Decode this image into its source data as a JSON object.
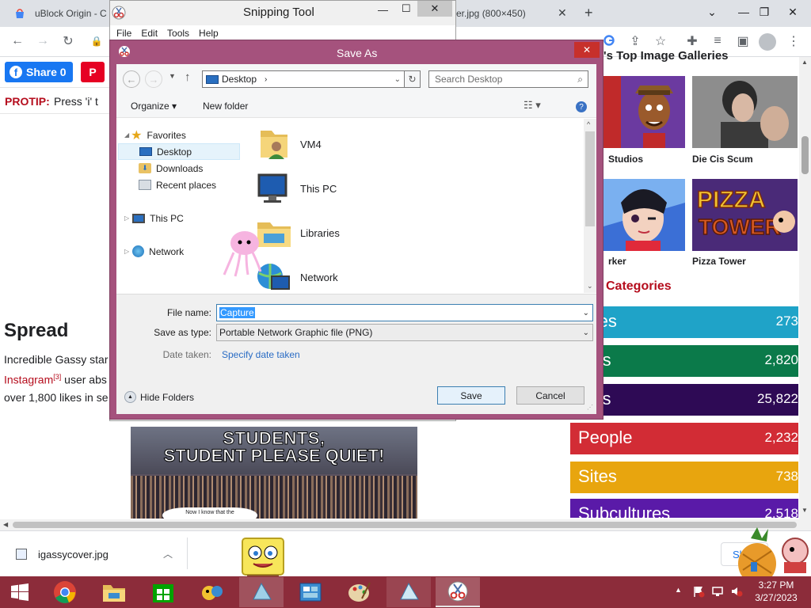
{
  "browser": {
    "tabs": [
      {
        "title": "uBlock Origin - C"
      },
      {
        "title": "er.jpg (800×450)"
      }
    ],
    "new_tab": "+",
    "controls": {
      "dropdown": "⌄",
      "minimize": "—",
      "restore": "❐",
      "close": "✕"
    }
  },
  "page": {
    "share_label": "Share 0",
    "protip_label": "PROTIP:",
    "protip_text": "Press 'i' t",
    "spread_heading": "Spread",
    "spread_line1": "Incredible Gassy star",
    "spread_link": "Instagram",
    "spread_sup": "[3]",
    "spread_line2_rest": " user abs",
    "spread_line3": "over 1,800 likes in se",
    "image_line1": "STUDENTS,",
    "image_line2": "STUDENT PLEASE QUIET!",
    "image_caption": "Now I know that the",
    "galleries_title": "'s Top Image Galleries",
    "gallery_items": [
      {
        "label": "Studios"
      },
      {
        "label": "Die Cis Scum"
      },
      {
        "label": "rker"
      },
      {
        "label": "Pizza Tower"
      }
    ],
    "pizza_logo_l1": "PIZZA",
    "pizza_logo_l2": "TOWER",
    "categories_title": "Categories",
    "categories": [
      {
        "name": "tures",
        "count": "273",
        "color": "#1fa3c8"
      },
      {
        "name": "ents",
        "count": "2,820",
        "color": "#0b7a4a"
      },
      {
        "name": "mes",
        "count": "25,822",
        "color": "#2e0a55"
      },
      {
        "name": "People",
        "count": "2,232",
        "color": "#d22c35"
      },
      {
        "name": "Sites",
        "count": "738",
        "color": "#e8a50e"
      },
      {
        "name": "Subcultures",
        "count": "2,518",
        "color": "#5a1aa8"
      }
    ]
  },
  "snipping": {
    "title": "Snipping Tool",
    "menu": [
      "File",
      "Edit",
      "Tools",
      "Help"
    ]
  },
  "dialog": {
    "title": "Save As",
    "location": "Desktop",
    "search_placeholder": "Search Desktop",
    "organize": "Organize",
    "new_folder": "New folder",
    "tree": [
      {
        "label": "Favorites",
        "icon": "star-icon"
      },
      {
        "label": "Desktop",
        "icon": "desktop-icon"
      },
      {
        "label": "Downloads",
        "icon": "downloads-icon"
      },
      {
        "label": "Recent places",
        "icon": "recent-places-icon"
      },
      {
        "label": "This PC",
        "icon": "computer-icon"
      },
      {
        "label": "Network",
        "icon": "network-icon"
      }
    ],
    "files": [
      {
        "label": "VM4",
        "icon": "user-folder-icon"
      },
      {
        "label": "This PC",
        "icon": "computer-icon"
      },
      {
        "label": "Libraries",
        "icon": "libraries-icon"
      },
      {
        "label": "Network",
        "icon": "network-icon"
      }
    ],
    "file_name_label": "File name:",
    "file_name_value": "Capture",
    "save_type_label": "Save as type:",
    "save_type_value": "Portable Network Graphic file (PNG)",
    "date_label": "Date taken:",
    "date_link": "Specify date taken",
    "hide_folders": "Hide Folders",
    "save": "Save",
    "cancel": "Cancel"
  },
  "downloads": {
    "file": "igassycover.jpg",
    "show_all": "Sh"
  },
  "taskbar": {
    "time": "3:27 PM",
    "date": "3/27/2023"
  }
}
